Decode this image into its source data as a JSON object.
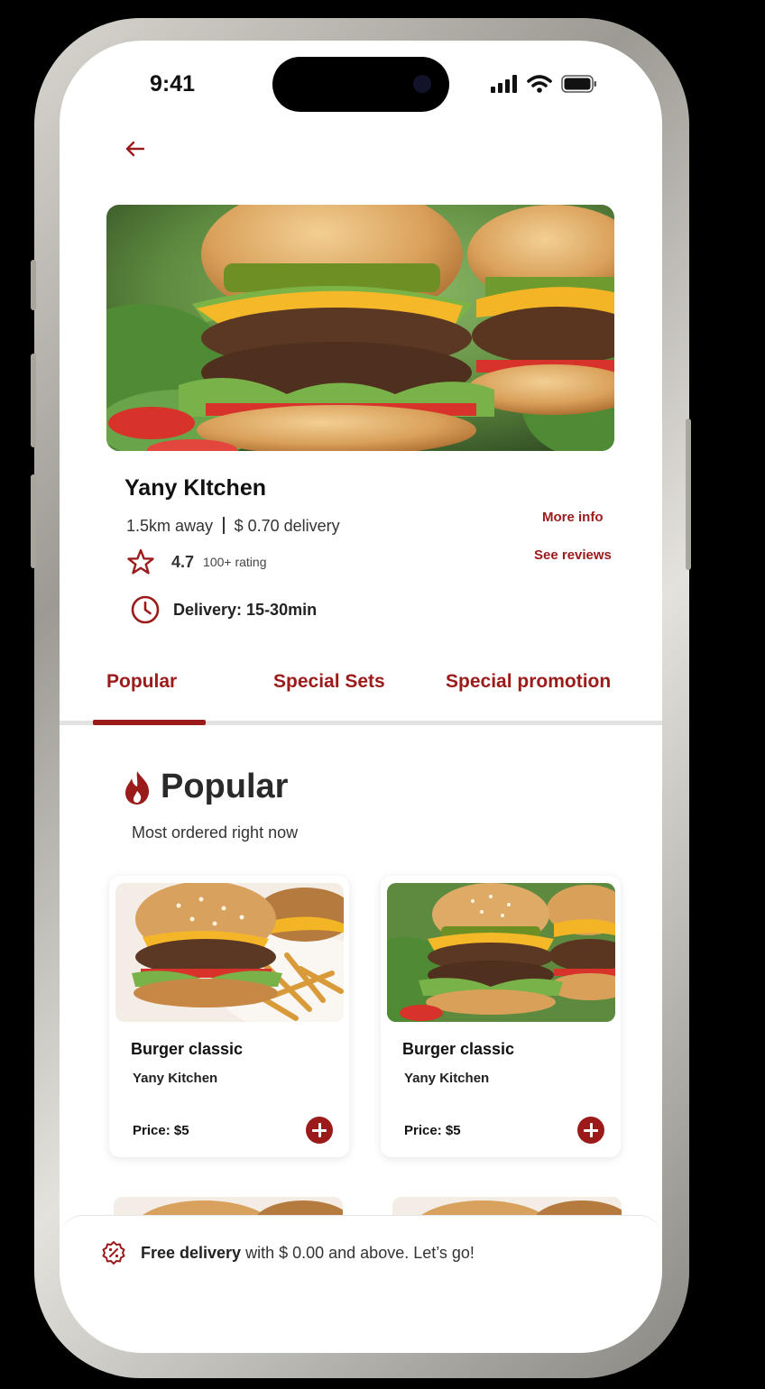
{
  "status": {
    "time": "9:41"
  },
  "restaurant": {
    "name": "Yany KItchen",
    "distance": "1.5km away",
    "delivery_fee": "$ 0.70 delivery",
    "rating": "4.7",
    "rating_count": "100+ rating",
    "delivery_time": "Delivery: 15-30min",
    "more_info": "More info",
    "see_reviews": "See reviews"
  },
  "tabs": [
    {
      "label": "Popular",
      "active": true
    },
    {
      "label": "Special Sets",
      "active": false
    },
    {
      "label": "Special promotion",
      "active": false
    }
  ],
  "section": {
    "title": "Popular",
    "subtitle": "Most ordered right now"
  },
  "items": [
    {
      "title": "Burger classic",
      "restaurant": "Yany Kitchen",
      "price": "Price: $5"
    },
    {
      "title": "Burger classic",
      "restaurant": "Yany Kitchen",
      "price": "Price: $5"
    }
  ],
  "banner": {
    "bold": "Free delivery",
    "rest": " with $ 0.00 and above. Let’s go!"
  },
  "colors": {
    "accent": "#9b1b1b",
    "text": "#222222"
  },
  "icons": [
    "back-arrow-icon",
    "star-icon",
    "clock-icon",
    "flame-icon",
    "plus-icon",
    "discount-badge-icon",
    "signal-icon",
    "wifi-icon",
    "battery-icon"
  ]
}
